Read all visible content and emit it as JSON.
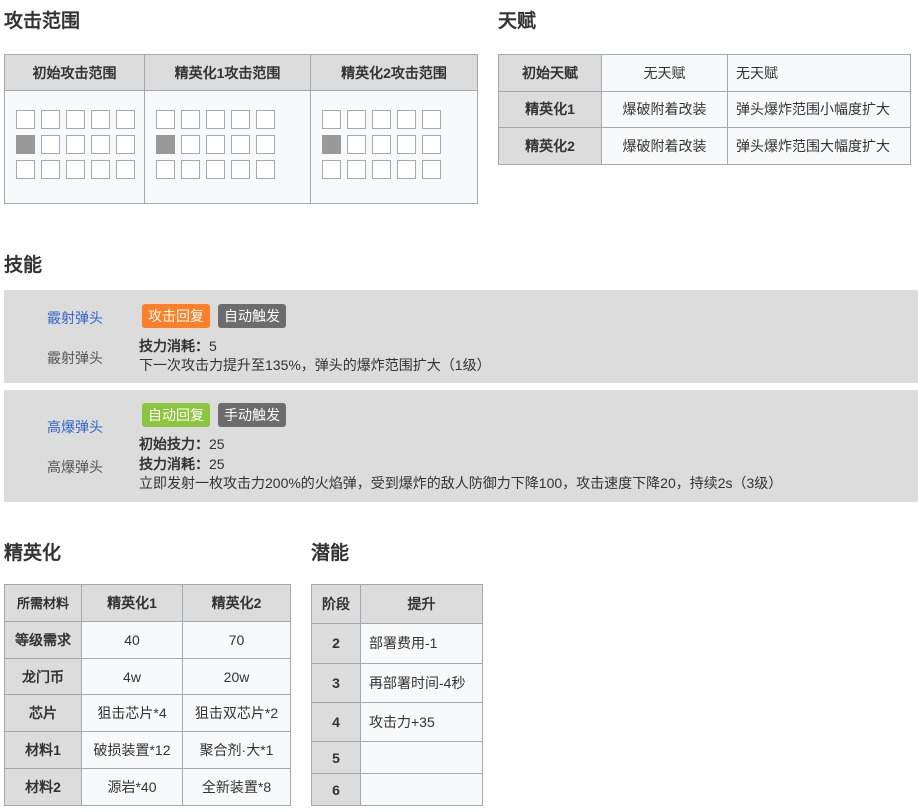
{
  "sections": {
    "range": "攻击范围",
    "talent": "天赋",
    "skills": "技能",
    "elite": "精英化",
    "potential": "潜能"
  },
  "range_table": {
    "headers": [
      "初始攻击范围",
      "精英化1攻击范围",
      "精英化2攻击范围"
    ]
  },
  "talent_table": {
    "rows": [
      {
        "label": "初始天赋",
        "name": "无天赋",
        "desc": "无天赋"
      },
      {
        "label": "精英化1",
        "name": "爆破附着改装",
        "desc": "弹头爆炸范围小幅度扩大"
      },
      {
        "label": "精英化2",
        "name": "爆破附着改装",
        "desc": "弹头爆炸范围大幅度扩大"
      }
    ]
  },
  "skills": [
    {
      "link_name": "霰射弹头",
      "name": "霰射弹头",
      "recovery_tag": "攻击回复",
      "trigger_tag": "自动触发",
      "cost_label": "技力消耗：",
      "cost_value": "5",
      "description": "下一次攻击力提升至135%，弹头的爆炸范围扩大（1级）"
    },
    {
      "link_name": "高爆弹头",
      "name": "高爆弹头",
      "recovery_tag": "自动回复",
      "trigger_tag": "手动触发",
      "initial_label": "初始技力：",
      "initial_value": "25",
      "cost_label": "技力消耗：",
      "cost_value": "25",
      "description": "立即发射一枚攻击力200%的火焰弹，受到爆炸的敌人防御力下降100，攻击速度下降20，持续2s（3级）"
    }
  ],
  "elite_table": {
    "headers": [
      "所需材料",
      "精英化1",
      "精英化2"
    ],
    "rows": [
      {
        "label": "等级需求",
        "e1": "40",
        "e2": "70"
      },
      {
        "label": "龙门币",
        "e1": "4w",
        "e2": "20w"
      },
      {
        "label": "芯片",
        "e1": "狙击芯片*4",
        "e2": "狙击双芯片*2"
      },
      {
        "label": "材料1",
        "e1": "破损装置*12",
        "e2": "聚合剂·大*1"
      },
      {
        "label": "材料2",
        "e1": "源岩*40",
        "e2": "全新装置*8"
      }
    ]
  },
  "potential_table": {
    "headers": [
      "阶段",
      "提升"
    ],
    "rows": [
      {
        "stage": "2",
        "effect": "部署费用-1"
      },
      {
        "stage": "3",
        "effect": "再部署时间-4秒"
      },
      {
        "stage": "4",
        "effect": "攻击力+35"
      },
      {
        "stage": "5",
        "effect": ""
      },
      {
        "stage": "6",
        "effect": ""
      }
    ]
  },
  "colors": {
    "attack_recovery": "#ff7f27",
    "auto_recovery": "#8cc63f",
    "trigger": "#6c6c6c",
    "link": "#3366cc",
    "header_bg": "#dcdcdc"
  }
}
